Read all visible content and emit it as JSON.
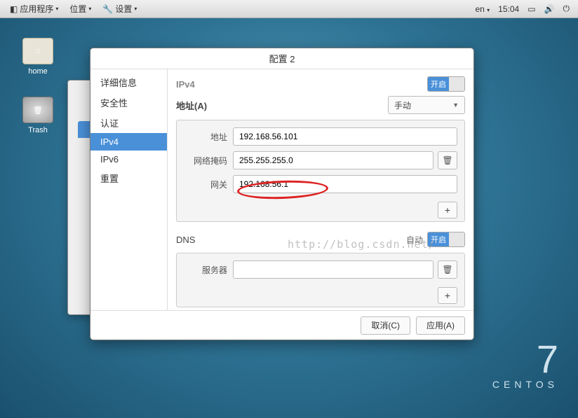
{
  "panel": {
    "apps": "应用程序",
    "places": "位置",
    "settings": "设置",
    "lang": "en",
    "time": "15:04"
  },
  "desktop": {
    "home": "home",
    "trash": "Trash",
    "brand_num": "7",
    "brand_word": "CENTOS"
  },
  "dialog": {
    "title": "配置 2",
    "sidebar": [
      "详细信息",
      "安全性",
      "认证",
      "IPv4",
      "IPv6",
      "重置"
    ],
    "selected_index": 3,
    "ipv4": {
      "section": "IPv4",
      "toggle_on": "开启",
      "addresses_label": "地址(A)",
      "method": "手动",
      "fields": {
        "address_label": "地址",
        "address_value": "192.168.56.101",
        "netmask_label": "网络掩码",
        "netmask_value": "255.255.255.0",
        "gateway_label": "网关",
        "gateway_value": "192.168.56.1"
      },
      "dns": {
        "section": "DNS",
        "auto": "自动",
        "toggle_on": "开启",
        "server_label": "服务器",
        "server_value": ""
      }
    },
    "buttons": {
      "cancel": "取消(C)",
      "apply": "应用(A)"
    }
  },
  "watermark": "http://blog.csdn.net/"
}
